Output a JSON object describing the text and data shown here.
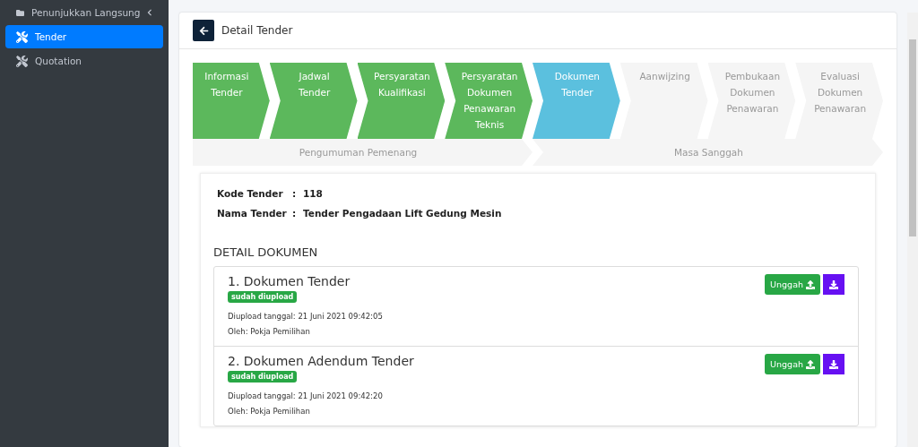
{
  "sidebar": {
    "items": [
      {
        "label": "Penunjukkan Langsung",
        "kind": "folder",
        "selected": false,
        "has_submenu": true
      },
      {
        "label": "Tender",
        "kind": "tool",
        "selected": true,
        "has_submenu": false
      },
      {
        "label": "Quotation",
        "kind": "tool",
        "selected": false,
        "has_submenu": false
      }
    ]
  },
  "header": {
    "title": "Detail Tender"
  },
  "steps": [
    {
      "label": "Informasi Tender",
      "completed": true,
      "selected": false
    },
    {
      "label": "Jadwal Tender",
      "completed": true,
      "selected": false
    },
    {
      "label": "Persyaratan Kualifikasi",
      "completed": true,
      "selected": false
    },
    {
      "label": "Persyaratan Dokumen Penawaran Teknis",
      "completed": true,
      "selected": false
    },
    {
      "label": "Dokumen Tender",
      "completed": false,
      "selected": true
    },
    {
      "label": "Aanwijzing",
      "completed": false,
      "selected": false
    },
    {
      "label": "Pembukaan Dokumen Penawaran",
      "completed": false,
      "selected": false
    },
    {
      "label": "Evaluasi Dokumen Penawaran",
      "completed": false,
      "selected": false
    }
  ],
  "steps_row_2": [
    {
      "label": "Pengumuman Pemenang",
      "completed": false,
      "selected": false
    },
    {
      "label": "Masa Sanggah",
      "completed": false,
      "selected": false
    }
  ],
  "info": [
    {
      "label": "Kode Tender",
      "colon": ":",
      "value": "118"
    },
    {
      "label": "Nama Tender",
      "colon": ":",
      "value": "Tender Pengadaan Lift Gedung Mesin"
    }
  ],
  "section_title": "DETAIL DOKUMEN",
  "documents": [
    {
      "title": "1. Dokumen Tender",
      "badge": "sudah diupload",
      "uploaded": "Diupload tanggal: 21 Juni 2021 09:42:05",
      "by": "Oleh: Pokja Pemilihan",
      "upload_button": "Unggah"
    },
    {
      "title": "2. Dokumen Adendum Tender",
      "badge": "sudah diupload",
      "uploaded": "Diupload tanggal: 21 Juni 2021 09:42:20",
      "by": "Oleh: Pokja Pemilihan",
      "upload_button": "Unggah"
    }
  ]
}
